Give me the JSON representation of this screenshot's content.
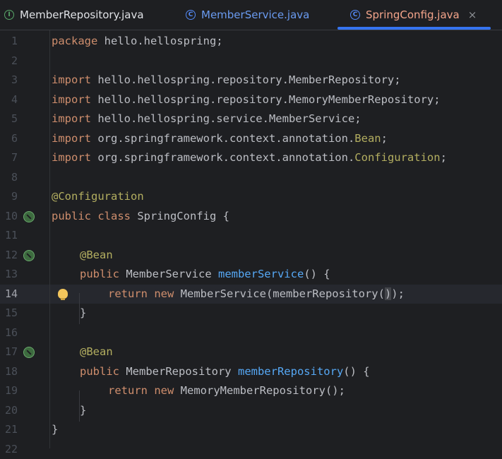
{
  "tabs": [
    {
      "icon": "I",
      "label": "MemberRepository.java",
      "kind": "interface"
    },
    {
      "icon": "C",
      "label": "MemberService.java",
      "kind": "class"
    },
    {
      "icon": "C",
      "label": "SpringConfig.java",
      "kind": "class",
      "active": true,
      "close": "×"
    }
  ],
  "editor": {
    "current_line": 14,
    "line_numbers": [
      "1",
      "2",
      "3",
      "4",
      "5",
      "6",
      "7",
      "8",
      "9",
      "10",
      "11",
      "12",
      "13",
      "14",
      "15",
      "16",
      "17",
      "18",
      "19",
      "20",
      "21",
      "22"
    ],
    "lines": {
      "l1": {
        "kw": "package",
        "rest": " hello.hellospring;"
      },
      "l3": {
        "kw": "import",
        "rest": " hello.hellospring.repository.MemberRepository;"
      },
      "l4": {
        "kw": "import",
        "rest": " hello.hellospring.repository.MemoryMemberRepository;"
      },
      "l5": {
        "kw": "import",
        "rest": " hello.hellospring.service.MemberService;"
      },
      "l6": {
        "kw": "import",
        "pre": " org.springframework.context.annotation.",
        "ann": "Bean",
        "post": ";"
      },
      "l7": {
        "kw": "import",
        "pre": " org.springframework.context.annotation.",
        "ann": "Configuration",
        "post": ";"
      },
      "l9": {
        "ann": "@Configuration"
      },
      "l10": {
        "kw": "public class",
        "rest": " SpringConfig {"
      },
      "l12": {
        "ann": "@Bean"
      },
      "l13": {
        "kw": "public",
        "pre": " MemberService ",
        "fn": "memberService",
        "post": "() {"
      },
      "l14": {
        "kw": "return new",
        "pre": " MemberService(memberRepository(",
        "brk": ")",
        "post": ");"
      },
      "l15": {
        "rest": "}"
      },
      "l17": {
        "ann": "@Bean"
      },
      "l18": {
        "kw": "public",
        "pre": " MemberRepository ",
        "fn": "memberRepository",
        "post": "() {"
      },
      "l19": {
        "kw": "return new",
        "rest": " MemoryMemberRepository();"
      },
      "l20": {
        "rest": "}"
      },
      "l21": {
        "rest": "}"
      }
    }
  },
  "colors": {
    "background": "#1e1f22",
    "keyword": "#cf8e6d",
    "annotation": "#b3ae60",
    "function": "#56a8f5",
    "text": "#bcbec4",
    "active_tab": "#f3a48a",
    "tab_underline": "#3574f0"
  }
}
